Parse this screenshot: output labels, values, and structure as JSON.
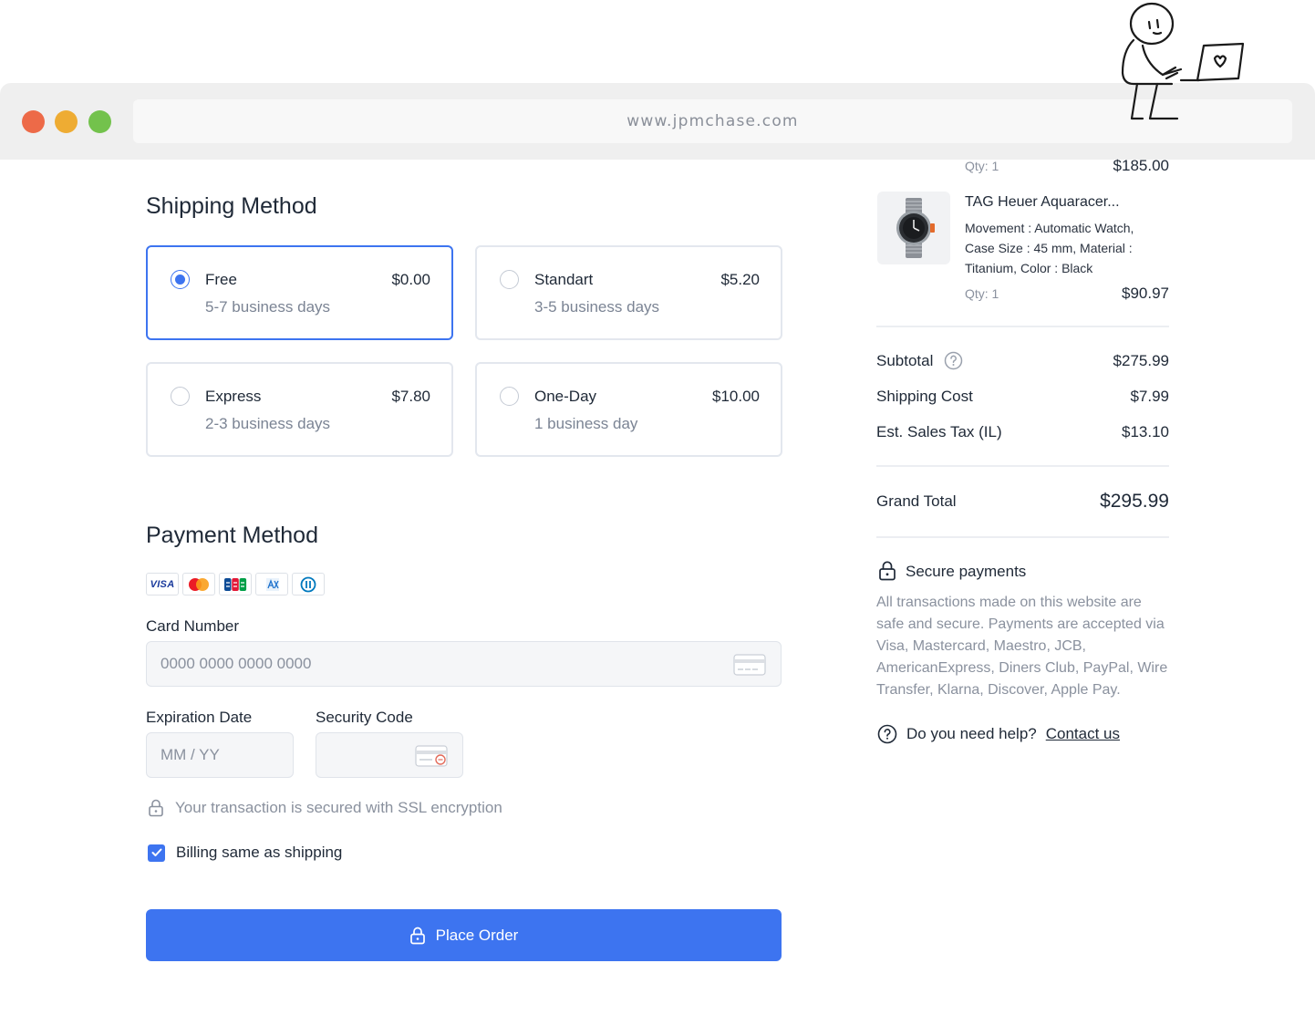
{
  "browser": {
    "url": "www.jpmchase.com"
  },
  "shipping": {
    "title": "Shipping Method",
    "options": [
      {
        "name": "Free",
        "price": "$0.00",
        "days": "5-7 business days",
        "selected": true
      },
      {
        "name": "Standart",
        "price": "$5.20",
        "days": "3-5 business days",
        "selected": false
      },
      {
        "name": "Express",
        "price": "$7.80",
        "days": "2-3 business days",
        "selected": false
      },
      {
        "name": "One-Day",
        "price": "$10.00",
        "days": "1 business day",
        "selected": false
      }
    ]
  },
  "payment": {
    "title": "Payment Method",
    "card_brands": [
      "visa-icon",
      "mastercard-icon",
      "jcb-icon",
      "amex-icon",
      "diners-club-icon"
    ],
    "visa_text": "VISA",
    "card_number_label": "Card Number",
    "card_number_placeholder": "0000 0000 0000 0000",
    "expiration_label": "Expiration Date",
    "expiration_placeholder": "MM / YY",
    "security_label": "Security Code",
    "ssl_text": "Your transaction is secured with SSL encryption",
    "billing_label": "Billing same as shipping",
    "billing_checked": true,
    "place_order": "Place Order"
  },
  "summary": {
    "prev_item": {
      "qty": "Qty: 1",
      "price": "$185.00"
    },
    "item": {
      "name": "TAG Heuer Aquaracer...",
      "spec1": "Movement : Automatic Watch,",
      "spec2": "Case Size : 45 mm, Material :",
      "spec3": "Titanium, Color : Black",
      "qty": "Qty: 1",
      "price": "$90.97"
    },
    "subtotal_label": "Subtotal",
    "subtotal": "$275.99",
    "shipping_label": "Shipping Cost",
    "shipping": "$7.99",
    "tax_label": "Est. Sales Tax (IL)",
    "tax": "$13.10",
    "grand_label": "Grand Total",
    "grand": "$295.99",
    "secure_title": "Secure payments",
    "secure_text": "All transactions made on this website are safe and secure. Payments are accepted via Visa, Mastercard, Maestro, JCB, AmericanExpress, Diners Club, PayPal, Wire Transfer, Klarna, Discover, Apple Pay.",
    "help_text": "Do you need help?",
    "help_link": "Contact us"
  },
  "colors": {
    "accent": "#3d74f0",
    "border": "#e3e7ee",
    "muted": "#8a919e"
  }
}
